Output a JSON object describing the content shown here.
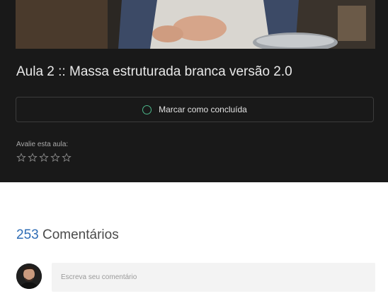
{
  "lesson": {
    "title": "Aula 2 :: Massa estruturada branca versão 2.0",
    "complete_label": "Marcar como concluída",
    "rate_label": "Avalie esta aula:",
    "rating": 0,
    "max_rating": 5
  },
  "comments": {
    "count": "253",
    "label": " Comentários",
    "input_placeholder": "Escreva seu comentário"
  },
  "colors": {
    "dark_background": "#191919",
    "accent_green": "#4cb78a",
    "count_blue": "#2f6db5"
  },
  "icons": {
    "complete": "circle-outline-icon",
    "star": "star-outline-icon"
  }
}
